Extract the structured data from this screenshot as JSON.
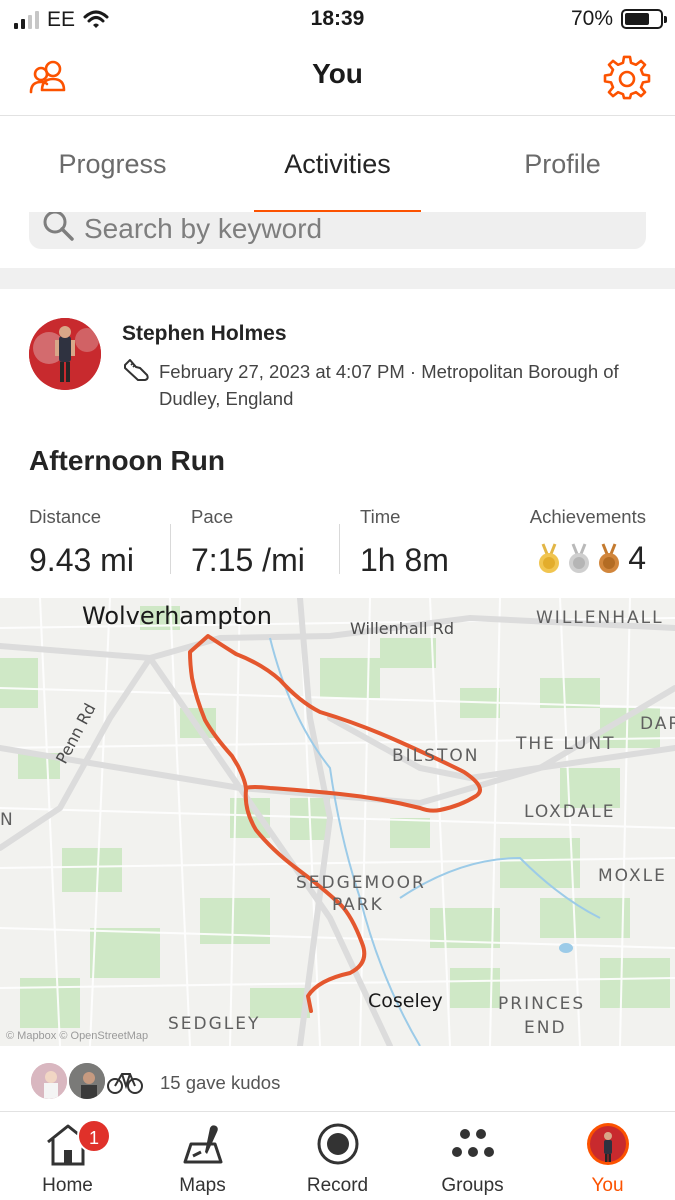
{
  "status_bar": {
    "carrier": "EE",
    "time": "18:39",
    "battery_percent": "70%",
    "battery_level": 0.7,
    "icons": [
      "cellular-signal-icon",
      "wifi-icon",
      "battery-icon"
    ]
  },
  "header": {
    "title": "You",
    "left_icon": "people-icon",
    "right_icon": "settings-gear-icon"
  },
  "tabs": [
    {
      "label": "Progress",
      "active": false
    },
    {
      "label": "Activities",
      "active": true
    },
    {
      "label": "Profile",
      "active": false
    }
  ],
  "search": {
    "placeholder": "Search by keyword"
  },
  "activity": {
    "athlete_name": "Stephen Holmes",
    "activity_type_icon": "running-shoe-icon",
    "meta": "February 27, 2023 at 4:07 PM · Metropolitan Borough of Dudley, England",
    "title": "Afternoon Run",
    "stats": [
      {
        "label": "Distance",
        "value": "9.43 mi"
      },
      {
        "label": "Pace",
        "value": "7:15 /mi"
      },
      {
        "label": "Time",
        "value": "1h 8m"
      }
    ],
    "achievements": {
      "label": "Achievements",
      "medals": [
        "gold-medal-icon",
        "silver-medal-icon",
        "bronze-medal-icon"
      ],
      "count": "4"
    }
  },
  "map": {
    "labels": {
      "wolverhampton": "Wolverhampton",
      "willenhall_rd": "Willenhall Rd",
      "willenhall": "WILLENHALL",
      "darlaston": "DAR",
      "bilston": "BILSTON",
      "the_lunt": "THE LUNT",
      "loxdale": "LOXDALE",
      "penn_rd": "Penn Rd",
      "moxley": "MOXLE",
      "west_edge": "N",
      "sedgemoor": "SEDGEMOOR",
      "park": "PARK",
      "coseley": "Coseley",
      "princes": "PRINCES",
      "end": "END",
      "sedgley": "SEDGLEY"
    },
    "attribution": "© Mapbox © OpenStreetMap",
    "route_color": "#e4572e"
  },
  "kudos": {
    "text": "15 gave kudos"
  },
  "bottom_nav": [
    {
      "label": "Home",
      "icon": "home-icon",
      "badge": "1",
      "active": false
    },
    {
      "label": "Maps",
      "icon": "map-pin-icon",
      "active": false
    },
    {
      "label": "Record",
      "icon": "record-icon",
      "active": false
    },
    {
      "label": "Groups",
      "icon": "groups-icon",
      "active": false
    },
    {
      "label": "You",
      "icon": "profile-avatar-icon",
      "active": true
    }
  ],
  "colors": {
    "accent": "#fc5200",
    "text": "#242424",
    "muted": "#6b6b6b",
    "badge": "#e0312a"
  }
}
